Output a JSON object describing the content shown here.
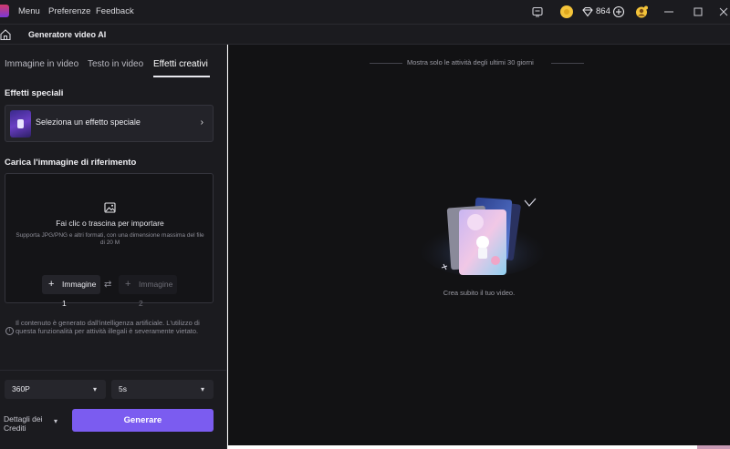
{
  "titlebar": {
    "menu": [
      "Menu",
      "Preferenze",
      "Feedback"
    ],
    "credit_count": "864"
  },
  "subbar": {
    "title": "Generatore video AI"
  },
  "tabs": [
    {
      "label": "Immagine in video",
      "active": false
    },
    {
      "label": "Testo in video",
      "active": false
    },
    {
      "label": "Effetti creativi",
      "active": true
    }
  ],
  "effects": {
    "section_title": "Effetti speciali",
    "select_label": "Seleziona un effetto speciale"
  },
  "upload": {
    "section_title": "Carica l'immagine di riferimento",
    "title": "Fai clic o trascina per importare",
    "description": "Supporta JPG/PNG e altri formati, con una dimensione massima del file di 20 M",
    "image1": "Immagine 1",
    "image2": "Immagine 2"
  },
  "disclaimer": "Il contenuto è generato dall'intelligenza artificiale. L'utilizzo di questa funzionalità per attività illegali è severamente vietato.",
  "settings": {
    "resolution": "360P",
    "duration": "5s",
    "credit_details": "Dettagli dei Crediti",
    "generate": "Generare"
  },
  "history": {
    "filter": "Mostra solo le attività degli ultimi 30 giorni",
    "empty_message": "Crea subito il tuo video."
  },
  "colors": {
    "accent": "#7b5cf0",
    "panel": "#1b1b1f",
    "canvas": "#121214",
    "coin": "#f4c43a"
  }
}
